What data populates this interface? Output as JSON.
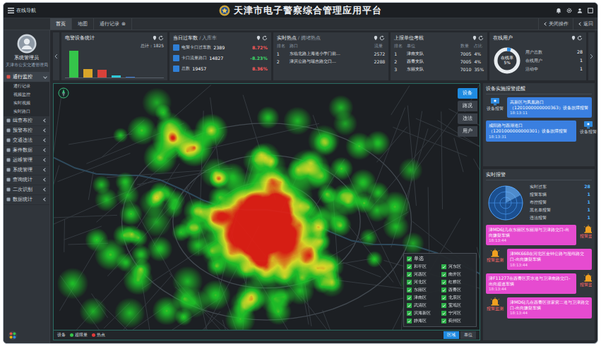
{
  "header": {
    "nav": "在线导航",
    "title": "天津市电子警察综合管理应用平台"
  },
  "tabs": [
    {
      "label": "首页",
      "selected": true
    },
    {
      "label": "地图",
      "selected": false
    },
    {
      "label": "通行记录",
      "selected": false,
      "close": "⊗"
    }
  ],
  "tab_actions": [
    "关闭操作",
    "返回"
  ],
  "user": {
    "name": "系统管理员",
    "org": "天津市公安交通管理局"
  },
  "sidebar": {
    "items": [
      {
        "label": "通行监控",
        "expanded": true,
        "children": [
          {
            "label": "通行记录",
            "selected": false
          },
          {
            "label": "视频监控",
            "selected": false
          },
          {
            "label": "实时视频",
            "selected": false
          },
          {
            "label": "实时路口",
            "selected": false
          }
        ]
      },
      {
        "label": "缉查布控",
        "expanded": false,
        "children": []
      },
      {
        "label": "预警布控",
        "expanded": false,
        "children": []
      },
      {
        "label": "交通违法",
        "expanded": false,
        "children": []
      },
      {
        "label": "案件数据",
        "expanded": false,
        "children": []
      },
      {
        "label": "运维管理",
        "expanded": false,
        "children": []
      },
      {
        "label": "系统管理",
        "expanded": false,
        "children": []
      },
      {
        "label": "查询统计",
        "expanded": false,
        "children": []
      },
      {
        "label": "二次识别",
        "expanded": false,
        "children": []
      },
      {
        "label": "数据统计",
        "expanded": false,
        "children": []
      }
    ]
  },
  "stats": {
    "devices": {
      "title": "电警设备统计",
      "total": "总计：1825",
      "bars": [
        {
          "value": 1500,
          "color": "#35c44a"
        },
        {
          "value": 460,
          "color": "#d8a52a"
        },
        {
          "value": 420,
          "color": "#d9413a"
        },
        {
          "value": 110,
          "color": "#2fc8d8"
        },
        {
          "value": 50,
          "color": "#3a7bd5"
        }
      ]
    },
    "traffic": {
      "title": "当日过车数",
      "subtitle": "/ 入库率",
      "rows": [
        {
          "label": "电警卡口过车数",
          "value": "2389",
          "rate": "8.72%",
          "color": "#ff5a5a"
        },
        {
          "label": "卡口流量路口",
          "value": "14827",
          "rate": "-8.23%",
          "color": "#3ddc6a"
        },
        {
          "label": "总数",
          "value": "19457",
          "rate": "8.36%",
          "color": "#ff5a5a"
        }
      ]
    },
    "hotspots": {
      "title": "实时热点",
      "subtitle": "/ 拥堵热点",
      "columns": [
        "排名",
        "路口",
        "流量"
      ],
      "rows": [
        [
          "1",
          "东临北路上海道小学门前…",
          "2572"
        ],
        [
          "2",
          "津滨公路与瑞吉路交口…",
          "2288"
        ]
      ]
    },
    "units": {
      "title": "上报单位考核",
      "columns": [
        "排名",
        "单位",
        "数量",
        "占比"
      ],
      "rows": [
        [
          "1",
          "津南支队",
          "7005",
          "4%"
        ],
        [
          "2",
          "西青支队",
          "7005",
          "4%"
        ],
        [
          "3",
          "东丽支队",
          "7010",
          "35%"
        ]
      ]
    },
    "online": {
      "title": "在线用户",
      "ring_label": "在线率",
      "ring_value": "5%",
      "level": 0.05,
      "rows": [
        {
          "label": "用户总数",
          "value": "28"
        },
        {
          "label": "在线用户",
          "value": "1"
        },
        {
          "label": "活动中",
          "value": "1"
        }
      ]
    }
  },
  "map": {
    "buttons": [
      {
        "label": "设备",
        "selected": true
      },
      {
        "label": "路况",
        "selected": false
      },
      {
        "label": "违法",
        "selected": false
      },
      {
        "label": "用户",
        "selected": false
      }
    ],
    "districts": {
      "title": "单选",
      "checked": true,
      "items": [
        {
          "label": "和平区",
          "checked": true
        },
        {
          "label": "河东区",
          "checked": true
        },
        {
          "label": "河西区",
          "checked": true
        },
        {
          "label": "南开区",
          "checked": true
        },
        {
          "label": "河北区",
          "checked": true
        },
        {
          "label": "红桥区",
          "checked": true
        },
        {
          "label": "东丽区",
          "checked": true
        },
        {
          "label": "西青区",
          "checked": true
        },
        {
          "label": "津南区",
          "checked": true
        },
        {
          "label": "北辰区",
          "checked": true
        },
        {
          "label": "武清区",
          "checked": true
        },
        {
          "label": "宝坻区",
          "checked": true
        },
        {
          "label": "滨海新区",
          "checked": true
        },
        {
          "label": "宁河区",
          "checked": true
        },
        {
          "label": "静海区",
          "checked": true
        },
        {
          "label": "蓟州区",
          "checked": true
        }
      ]
    },
    "footer": {
      "title": "设备",
      "legend": [
        {
          "label": "超限量",
          "color": "#35c44a"
        },
        {
          "label": "热点",
          "color": "#e03a3a"
        }
      ],
      "tabs": [
        {
          "label": "区域",
          "selected": true
        },
        {
          "label": "单位",
          "selected": false
        }
      ]
    }
  },
  "device_alerts": {
    "title": "设备实施报警提醒",
    "messages": [
      {
        "text": "高新区与凤凰路口（1201000000000363）设备故障报警",
        "time": "18:13:11",
        "sender": "设备报警",
        "side": "left"
      },
      {
        "text": "咸阳路与西湖道口（1201000000000301）设备故障报警",
        "time": "18:13:31",
        "sender": "设备报警",
        "side": "right"
      }
    ]
  },
  "realtime": {
    "title": "实时报警",
    "stats": [
      {
        "label": "实时过车",
        "value": "28"
      },
      {
        "label": "报警车辆",
        "value": "1"
      },
      {
        "label": "布控报警",
        "value": "1"
      },
      {
        "label": "黑名单报警",
        "value": "1"
      },
      {
        "label": "违法报警",
        "value": "1"
      }
    ],
    "alarms": [
      {
        "text": "津MD6J几在东丽区东丽湖与卫津路交口-出向嫌疑车辆",
        "time": "18:13:44",
        "sender": "报警监测",
        "side": "right"
      },
      {
        "text": "津MK668在河北区金钟公路与昆纬路交口-出向嫌疑车辆",
        "time": "18:13:44",
        "sender": "报警监测",
        "side": "left"
      },
      {
        "text": "津F11277在西青区宾水道与卫津南路交口-出向超速车辆",
        "time": "18:13:44",
        "sender": "报警监测",
        "side": "right"
      },
      {
        "text": "津MD6J几在西青区张家窝二道与卫津路交口-出向嫌疑车辆",
        "time": "18:13:44",
        "sender": "报警监测",
        "side": "left"
      }
    ]
  }
}
